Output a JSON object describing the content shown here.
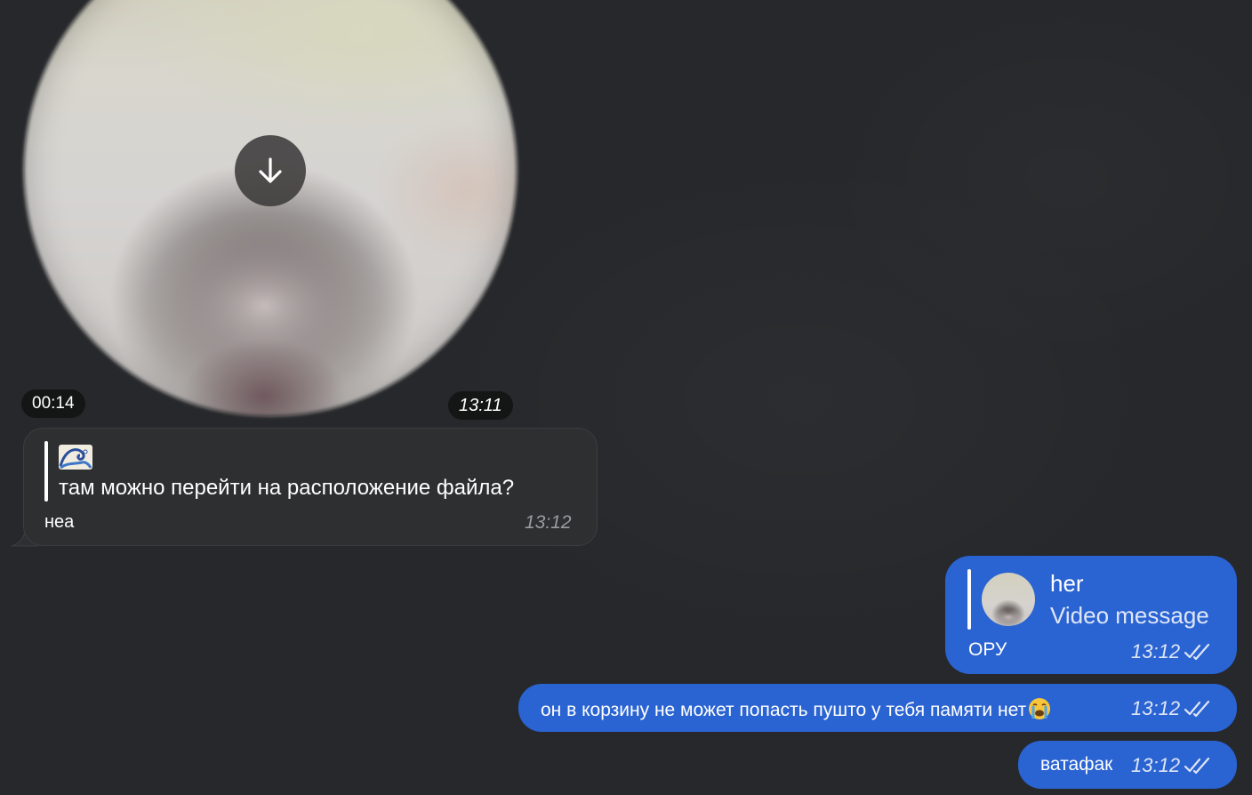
{
  "video_message": {
    "duration": "00:14",
    "time": "13:11",
    "download_icon": "arrow-down-icon"
  },
  "incoming_message": {
    "reply_emoji": "🌊",
    "reply_text": "там можно перейти на расположение файла?",
    "text": "неа",
    "time": "13:12"
  },
  "outgoing_messages": [
    {
      "reply_name": "her",
      "reply_sub": "Video message",
      "text": "ОРУ",
      "time": "13:12",
      "status_icon": "double-check-icon"
    },
    {
      "text": "он в корзину не может попасть пушто у тебя памяти нет",
      "emoji": "😭",
      "time": "13:12",
      "status_icon": "double-check-icon"
    },
    {
      "text": "ватафак",
      "time": "13:12",
      "status_icon": "double-check-icon"
    }
  ],
  "colors": {
    "background": "#26282b",
    "incoming_bubble": "#2e2f31",
    "outgoing_bubble": "#2a63d2"
  }
}
